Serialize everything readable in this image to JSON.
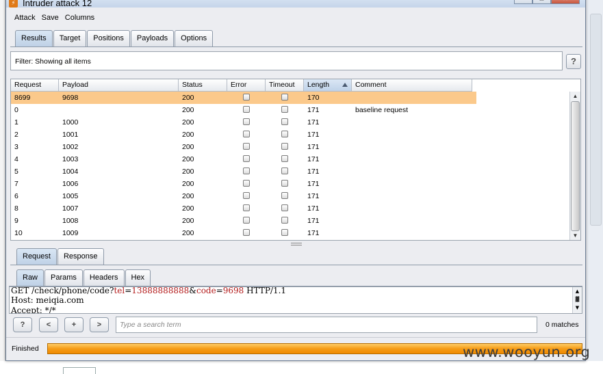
{
  "window": {
    "title": "Intruder attack 12"
  },
  "menu": [
    "Attack",
    "Save",
    "Columns"
  ],
  "main_tabs": [
    {
      "label": "Results",
      "active": true
    },
    {
      "label": "Target",
      "active": false
    },
    {
      "label": "Positions",
      "active": false
    },
    {
      "label": "Payloads",
      "active": false
    },
    {
      "label": "Options",
      "active": false
    }
  ],
  "filter": {
    "text": "Filter: Showing all items",
    "help_label": "?"
  },
  "table": {
    "columns": [
      "Request",
      "Payload",
      "Status",
      "Error",
      "Timeout",
      "Length",
      "Comment"
    ],
    "sorted_column": "Length",
    "rows": [
      {
        "request": "8699",
        "payload": "9698",
        "status": "200",
        "error": false,
        "timeout": false,
        "length": "170",
        "comment": "",
        "selected": true
      },
      {
        "request": "0",
        "payload": "",
        "status": "200",
        "error": false,
        "timeout": false,
        "length": "171",
        "comment": "baseline request",
        "selected": false
      },
      {
        "request": "1",
        "payload": "1000",
        "status": "200",
        "error": false,
        "timeout": false,
        "length": "171",
        "comment": "",
        "selected": false
      },
      {
        "request": "2",
        "payload": "1001",
        "status": "200",
        "error": false,
        "timeout": false,
        "length": "171",
        "comment": "",
        "selected": false
      },
      {
        "request": "3",
        "payload": "1002",
        "status": "200",
        "error": false,
        "timeout": false,
        "length": "171",
        "comment": "",
        "selected": false
      },
      {
        "request": "4",
        "payload": "1003",
        "status": "200",
        "error": false,
        "timeout": false,
        "length": "171",
        "comment": "",
        "selected": false
      },
      {
        "request": "5",
        "payload": "1004",
        "status": "200",
        "error": false,
        "timeout": false,
        "length": "171",
        "comment": "",
        "selected": false
      },
      {
        "request": "7",
        "payload": "1006",
        "status": "200",
        "error": false,
        "timeout": false,
        "length": "171",
        "comment": "",
        "selected": false
      },
      {
        "request": "6",
        "payload": "1005",
        "status": "200",
        "error": false,
        "timeout": false,
        "length": "171",
        "comment": "",
        "selected": false
      },
      {
        "request": "8",
        "payload": "1007",
        "status": "200",
        "error": false,
        "timeout": false,
        "length": "171",
        "comment": "",
        "selected": false
      },
      {
        "request": "9",
        "payload": "1008",
        "status": "200",
        "error": false,
        "timeout": false,
        "length": "171",
        "comment": "",
        "selected": false
      },
      {
        "request": "10",
        "payload": "1009",
        "status": "200",
        "error": false,
        "timeout": false,
        "length": "171",
        "comment": "",
        "selected": false
      }
    ]
  },
  "detail_tabs": [
    {
      "label": "Request",
      "active": true
    },
    {
      "label": "Response",
      "active": false
    }
  ],
  "view_tabs": [
    {
      "label": "Raw",
      "active": true
    },
    {
      "label": "Params",
      "active": false
    },
    {
      "label": "Headers",
      "active": false
    },
    {
      "label": "Hex",
      "active": false
    }
  ],
  "request_text": {
    "method_path": "GET /check/phone/code?",
    "param1_name": "tel",
    "eq1": "=",
    "param1_value": "13888888888",
    "amp": "&",
    "param2_name": "code",
    "eq2": "=",
    "param2_value": "9698",
    "protocol": " HTTP/1.1",
    "host_line": "Host: meiqia.com",
    "accept_line": "Accept: */*"
  },
  "search": {
    "help_label": "?",
    "prev_label": "<",
    "add_label": "+",
    "next_label": ">",
    "placeholder": "Type a search term",
    "matches": "0 matches"
  },
  "status": {
    "text": "Finished",
    "progress": 1.0
  },
  "watermark": "www.wooyun.org",
  "colors": {
    "selected_row": "#fbc98b",
    "progress": "#f59b16",
    "param_name": "#b31b1b",
    "param_value": "#1d34c8"
  }
}
